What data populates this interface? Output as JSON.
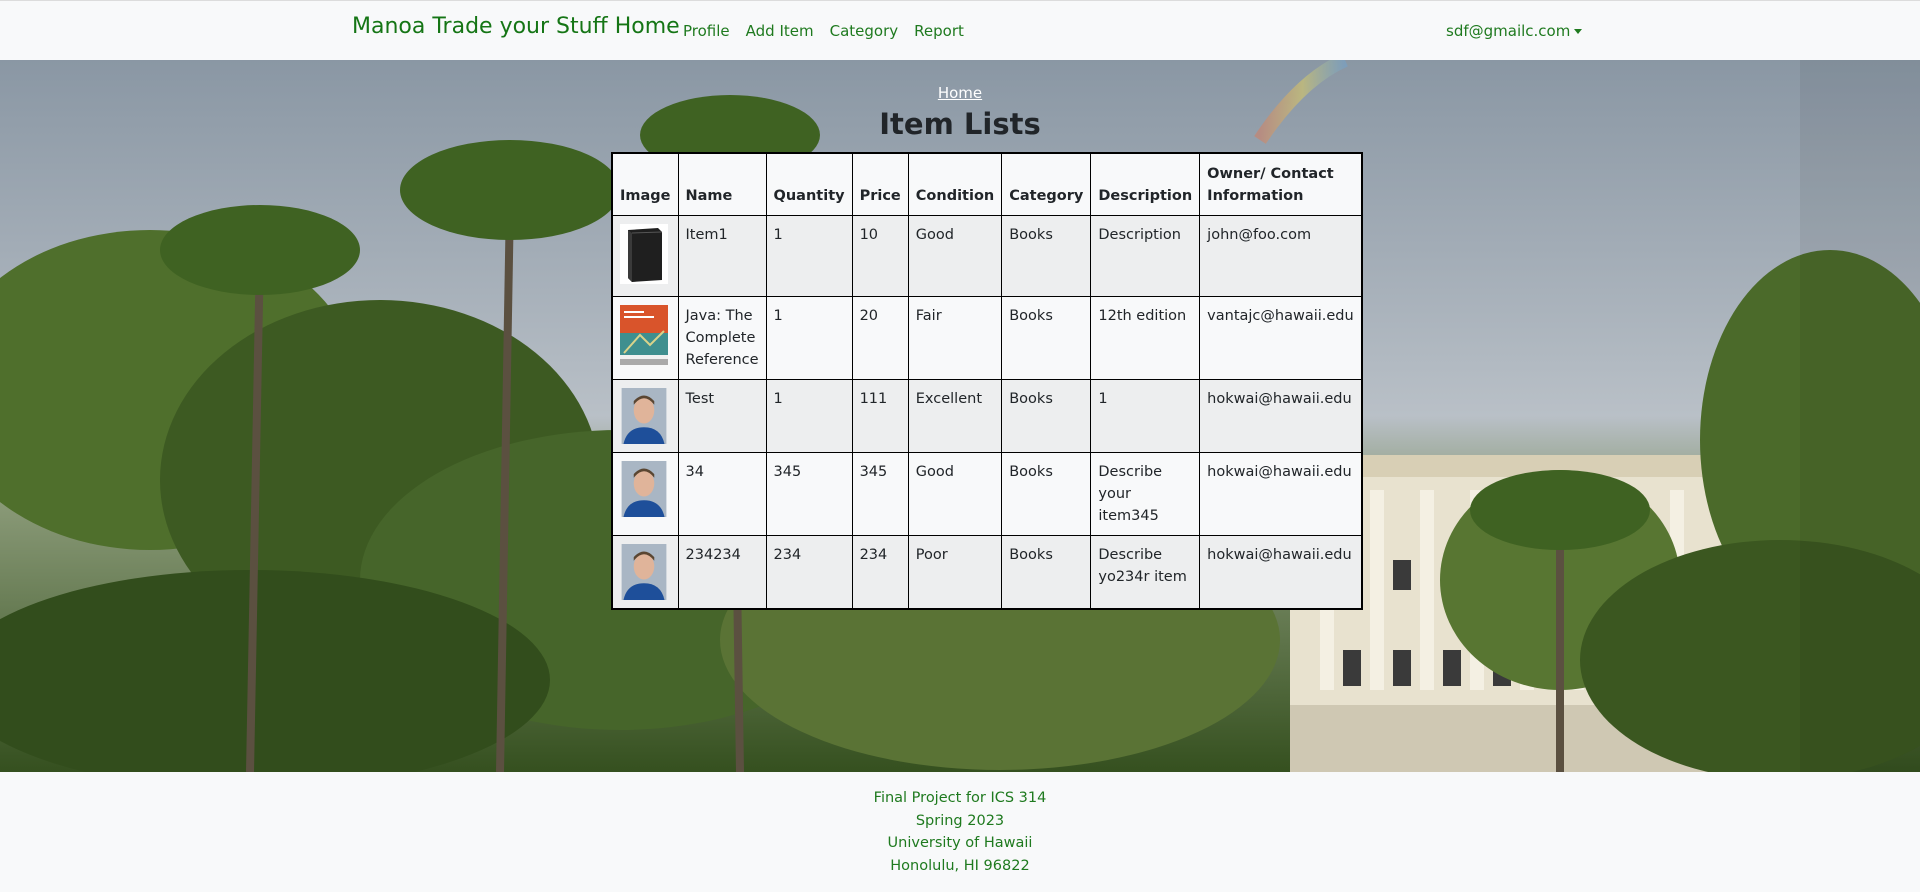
{
  "navbar": {
    "brand": "Manoa Trade your Stuff Home",
    "links": [
      "Profile",
      "Add Item",
      "Category",
      "Report"
    ],
    "user_email": "sdf@gmailc.com"
  },
  "page": {
    "breadcrumb": "Home",
    "title": "Item Lists"
  },
  "table": {
    "headers": [
      "Image",
      "Name",
      "Quantity",
      "Price",
      "Condition",
      "Category",
      "Description",
      "Owner/ Contact Information"
    ],
    "rows": [
      {
        "image": "book-icon",
        "name": "Item1",
        "quantity": "1",
        "price": "10",
        "condition": "Good",
        "category": "Books",
        "description": "Description",
        "owner": "john@foo.com"
      },
      {
        "image": "java-book-cover",
        "name": "Java: The Complete Reference",
        "quantity": "1",
        "price": "20",
        "condition": "Fair",
        "category": "Books",
        "description": "12th edition",
        "owner": "vantajc@hawaii.edu"
      },
      {
        "image": "person-photo",
        "name": "Test",
        "quantity": "1",
        "price": "111",
        "condition": "Excellent",
        "category": "Books",
        "description": "1",
        "owner": "hokwai@hawaii.edu"
      },
      {
        "image": "person-photo",
        "name": "34",
        "quantity": "345",
        "price": "345",
        "condition": "Good",
        "category": "Books",
        "description": "Describe your item345",
        "owner": "hokwai@hawaii.edu"
      },
      {
        "image": "person-photo",
        "name": "234234",
        "quantity": "234",
        "price": "234",
        "condition": "Poor",
        "category": "Books",
        "description": "Describe yo234r item",
        "owner": "hokwai@hawaii.edu"
      }
    ]
  },
  "footer": {
    "lines": [
      "Final Project for ICS 314",
      "Spring 2023",
      "University of Hawaii",
      "Honolulu, HI 96822"
    ]
  },
  "colors": {
    "brand_green": "#157515",
    "link_green": "#1f7a1f",
    "navbar_bg": "#f8f9fa"
  }
}
